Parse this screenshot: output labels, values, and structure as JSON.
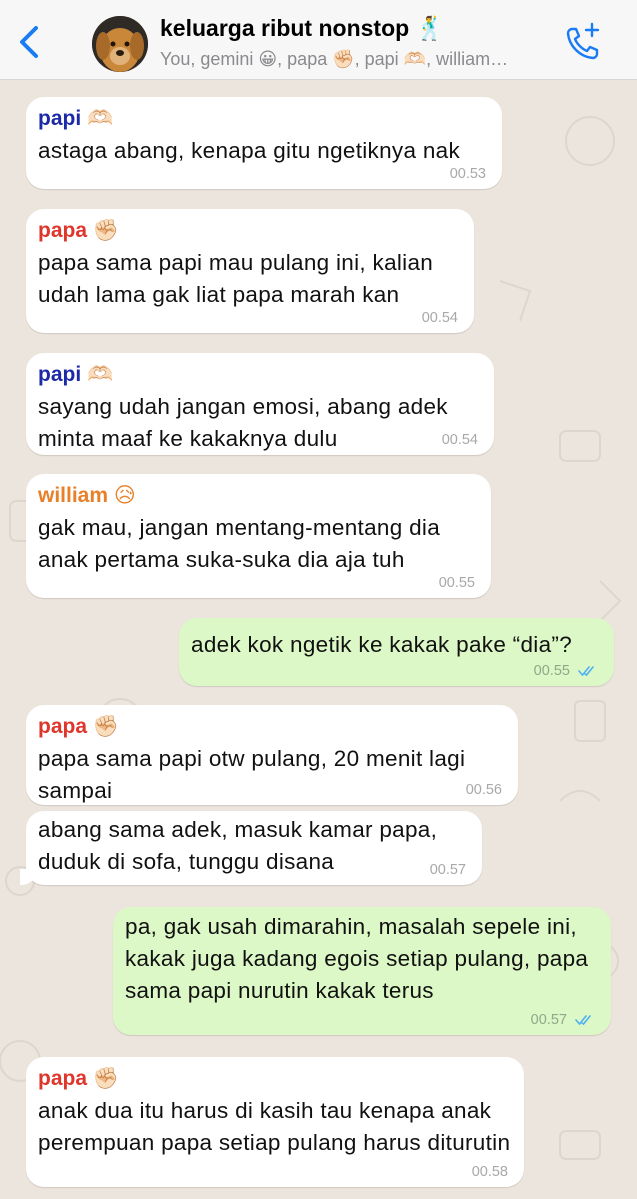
{
  "header": {
    "back_icon": "chevron-left-icon",
    "title": "keluarga ribut nonstop 🕺",
    "subtitle": "You, gemini 😀, papa ✊🏻, papi 🫶🏻, william…",
    "call_icon": "add-call-icon",
    "accent_color": "#1a7cf5"
  },
  "messages": [
    {
      "sender": "papi 🫶🏻",
      "sender_color": "#1d2aa8",
      "text": "astaga abang, kenapa gitu ngetiknya nak",
      "time": "00.53"
    },
    {
      "sender": "papa ✊🏻",
      "sender_color": "#e0352b",
      "text": "papa sama papi mau pulang ini, kalian udah lama gak liat papa marah kan",
      "time": "00.54"
    },
    {
      "sender": "papi 🫶🏻",
      "sender_color": "#1d2aa8",
      "text": "sayang udah jangan emosi, abang adek minta maaf ke kakaknya dulu",
      "time": "00.54"
    },
    {
      "sender": "william 😥",
      "sender_color": "#e8802a",
      "text": "gak mau, jangan mentang-mentang dia anak pertama suka-suka dia aja tuh",
      "time": "00.55"
    },
    {
      "sender": "",
      "text": "adek kok ngetik ke kakak pake “dia”?",
      "time": "00.55",
      "outgoing": true
    },
    {
      "sender": "papa ✊🏻",
      "sender_color": "#e0352b",
      "text": "papa sama papi otw pulang, 20 menit lagi sampai",
      "time": "00.56"
    },
    {
      "sender": "",
      "text": "abang sama adek, masuk kamar papa, duduk di sofa, tunggu disana",
      "time": "00.57"
    },
    {
      "sender": "",
      "text": "pa, gak usah dimarahin, masalah sepele ini, kakak juga kadang egois setiap pulang, papa sama papi nurutin kakak terus",
      "time": "00.57",
      "outgoing": true
    },
    {
      "sender": "papa ✊🏻",
      "sender_color": "#e0352b",
      "text": "anak dua itu harus di kasih tau kenapa anak perempuan papa setiap pulang harus diturutin",
      "time": "00.58"
    }
  ]
}
